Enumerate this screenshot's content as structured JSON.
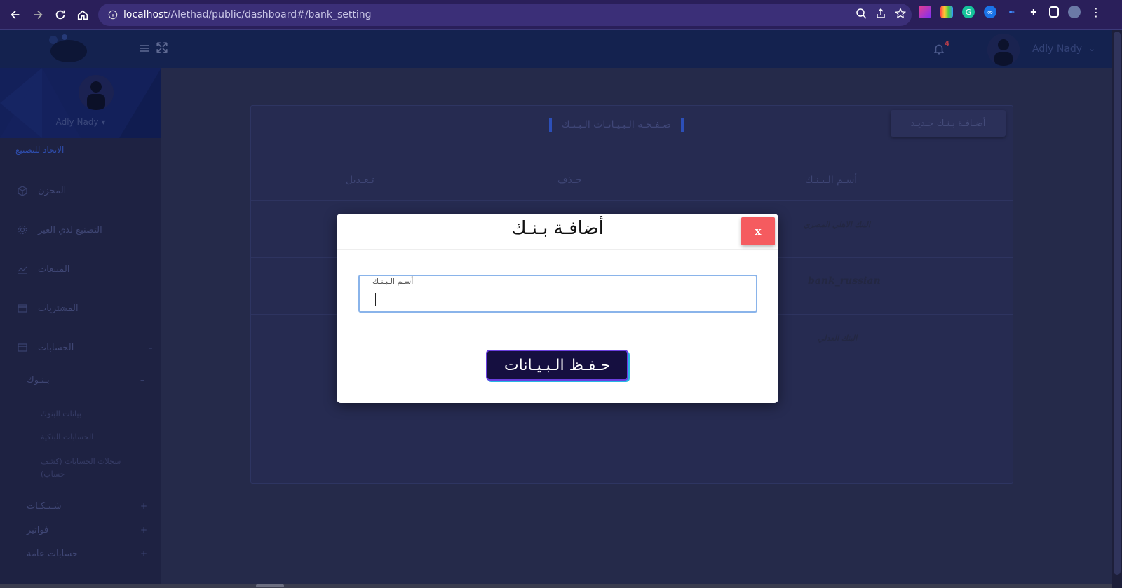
{
  "browser": {
    "url_host": "localhost",
    "url_path": "/Alethad/public/dashboard#/bank_setting"
  },
  "header": {
    "notification_count": "4",
    "user_name": "Adly Nady"
  },
  "sidebar": {
    "profile_name": "Adly Nady",
    "company_link": "الاتحاد للتصنيع",
    "items": [
      {
        "label": "المخزن",
        "icon": "box-icon"
      },
      {
        "label": "التصنيع لدي الغير",
        "icon": "gear-icon"
      },
      {
        "label": "المبيعات",
        "icon": "chart-line-icon"
      },
      {
        "label": "المشتريات",
        "icon": "card-icon"
      },
      {
        "label": "الحسابات",
        "icon": "card-icon"
      }
    ],
    "banks_group": "بـنـوك",
    "banks_sub": [
      "بيانات البنوك",
      "الحسابات البنكية",
      "سجلات الحسابات (كشف حساب)"
    ],
    "other_groups": [
      "شـيـكـات",
      "فواتير",
      "حسابات عامة"
    ]
  },
  "card": {
    "title": "صـفـحـة الـبـيـانـات الـبـنـك",
    "add_button": "أضـافـة بـنـك جـديـد",
    "columns": {
      "name": "أسـم الـبـنـك",
      "delete": "حـذف",
      "edit": "تـعـديل"
    },
    "banks": [
      "البنك الاهلي المصري",
      "bank_russian",
      "البنك العدلي"
    ]
  },
  "modal": {
    "title": "أضافـة بـنـك",
    "close_label": "x",
    "field_label": "أسـم الـبـنـك",
    "field_value": "",
    "save_label": "حـفـظ الـبـيـانات"
  },
  "colors": {
    "accent": "#2c4fb8",
    "close_button": "#f55b5f",
    "save_button_bg": "#150f40",
    "field_border": "#8ab4ea"
  }
}
